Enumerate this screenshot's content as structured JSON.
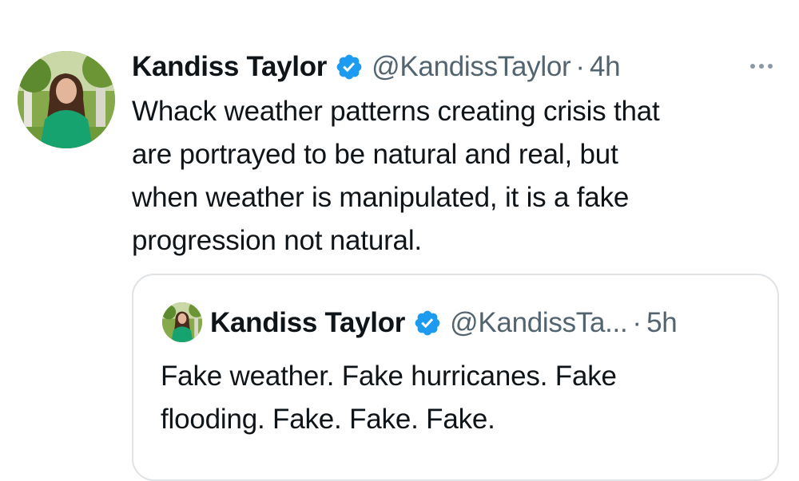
{
  "tweet": {
    "author": {
      "name": "Kandiss Taylor",
      "handle": "@KandissTaylor",
      "time": "4h"
    },
    "separator": "·",
    "text_lines": [
      "Whack weather patterns creating crisis that",
      "are portrayed to be natural and real, but",
      "when weather is manipulated, it is a fake",
      "progression not natural."
    ],
    "more_icon": "more-horizontal-icon",
    "verified_icon": "verified-badge-icon"
  },
  "quoted_tweet": {
    "author": {
      "name": "Kandiss Taylor",
      "handle": "@KandissTa...",
      "time": "5h"
    },
    "separator": "·",
    "text_lines": [
      "Fake weather. Fake hurricanes. Fake",
      "flooding. Fake. Fake. Fake."
    ]
  },
  "colors": {
    "text": "#0f1419",
    "secondary": "#536471",
    "verified": "#1d9bf0",
    "border": "#dfe3e6"
  }
}
